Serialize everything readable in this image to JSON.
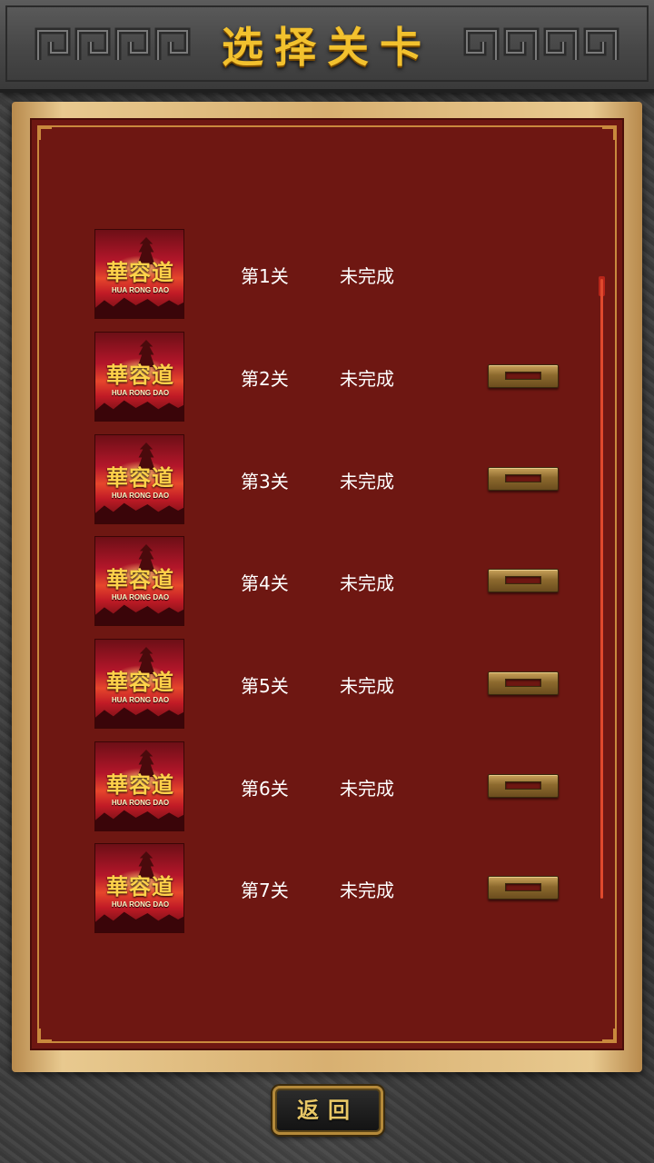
{
  "header": {
    "title": "选择关卡"
  },
  "levels": [
    {
      "name": "第1关",
      "status": "未完成",
      "locked": false,
      "thumbnail": {
        "logo": "華容道",
        "subtitle": "HUA RONG DAO"
      }
    },
    {
      "name": "第2关",
      "status": "未完成",
      "locked": true,
      "thumbnail": {
        "logo": "華容道",
        "subtitle": "HUA RONG DAO"
      }
    },
    {
      "name": "第3关",
      "status": "未完成",
      "locked": true,
      "thumbnail": {
        "logo": "華容道",
        "subtitle": "HUA RONG DAO"
      }
    },
    {
      "name": "第4关",
      "status": "未完成",
      "locked": true,
      "thumbnail": {
        "logo": "華容道",
        "subtitle": "HUA RONG DAO"
      }
    },
    {
      "name": "第5关",
      "status": "未完成",
      "locked": true,
      "thumbnail": {
        "logo": "華容道",
        "subtitle": "HUA RONG DAO"
      }
    },
    {
      "name": "第6关",
      "status": "未完成",
      "locked": true,
      "thumbnail": {
        "logo": "華容道",
        "subtitle": "HUA RONG DAO"
      }
    },
    {
      "name": "第7关",
      "status": "未完成",
      "locked": true,
      "thumbnail": {
        "logo": "華容道",
        "subtitle": "HUA RONG DAO"
      }
    }
  ],
  "footer": {
    "back_label": "返回"
  },
  "colors": {
    "title_gold": "#f2c12e",
    "panel_red": "#6e1712",
    "scrollbar": "#e0492d",
    "lock_bronze": "#8d6a2e"
  },
  "icons": {
    "lock": "lock-icon",
    "meander": "meander-pattern"
  }
}
